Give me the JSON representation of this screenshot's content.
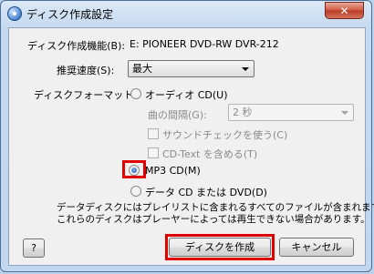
{
  "window": {
    "title": "ディスク作成設定",
    "close_glyph": "✕"
  },
  "form": {
    "drive_label": "ディスク作成機能(B):",
    "drive_value": "E: PIONEER DVD-RW  DVR-212",
    "speed_label": "推奨速度(S):",
    "speed_value": "最大",
    "format_label": "ディスクフォーマット:",
    "audio_cd_label": "オーディオ CD(U)",
    "gap_label": "曲の間隔(G):",
    "gap_value": "2 秒",
    "sound_check_label": "サウンドチェックを使う(C)",
    "cd_text_label": "CD-Text を含める(T)",
    "mp3_cd_label": "MP3 CD(M)",
    "data_cd_label": "データ CD または DVD(D)",
    "description_line1": "データディスクにはプレイリストに含まれるすべてのファイルが含まれます。",
    "description_line2": "これらのディスクはプレーヤーによっては再生できない場合があります。"
  },
  "buttons": {
    "help": "?",
    "burn": "ディスクを作成",
    "cancel": "キャンセル"
  },
  "selected_format": "mp3_cd",
  "colors": {
    "highlight": "#e00000",
    "window_frame": "#c2d7ef"
  }
}
